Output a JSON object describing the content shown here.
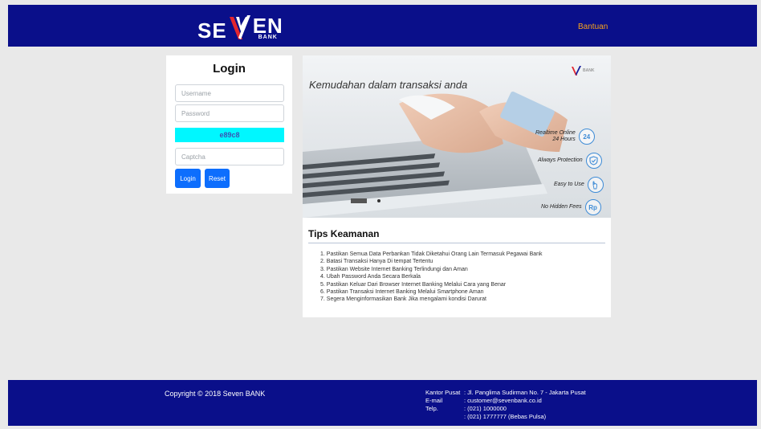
{
  "header": {
    "logo": {
      "left": "SE",
      "right": "EN",
      "sub": "BANK"
    },
    "help_link": "Bantuan"
  },
  "login": {
    "title": "Login",
    "username_placeholder": "Username",
    "password_placeholder": "Password",
    "captcha_code": "e89c8",
    "captcha_placeholder": "Captcha",
    "login_button": "Login",
    "reset_button": "Reset"
  },
  "hero": {
    "tagline": "Kemudahan dalam transaksi anda",
    "logo_text": "BANK",
    "features": [
      {
        "text_line1": "Realtime Online",
        "text_line2": "24 Hours",
        "icon": "24-hours-icon",
        "icon_text": "24"
      },
      {
        "text_line1": "Always Protection",
        "icon": "shield-check-icon"
      },
      {
        "text_line1": "Easy to Use",
        "icon": "hand-tap-icon"
      },
      {
        "text_line1": "No Hidden Fees",
        "icon": "rupiah-icon",
        "icon_text": "Rp"
      }
    ]
  },
  "tips": {
    "title": "Tips Keamanan",
    "items": [
      "1. Pastikan Semua Data Perbankan Tidak Diketahui Orang Lain Termasuk Pegawai Bank",
      "2. Batasi Transaksi Hanya Di tempat Tertentu",
      "3. Pastikan Website Internet Banking Terlindungi dan Aman",
      "4. Ubah Password Anda Secara Berkala",
      "5. Pastikan Keluar Dari Browser Internet Banking Melalui Cara yang Benar",
      "6. Pastikan Transaksi Internet Banking Melalui Smartphone Aman",
      "7. Segera Menginformasikan Bank Jika mengalami kondisi Darurat"
    ]
  },
  "footer": {
    "copyright": "Copyright © 2018 Seven BANK",
    "contact": [
      {
        "label": "Kantor Pusat",
        "value": ": Jl. Panglima Sudirman No. 7 - Jakarta Pusat"
      },
      {
        "label": "E-mail",
        "value": ": customer@sevenbank.co.id"
      },
      {
        "label": "Telp.",
        "value": ": (021) 1000000"
      },
      {
        "label": "",
        "value": ": (021) 1777777 (Bebas Pulsa)"
      }
    ]
  },
  "colors": {
    "brand_navy": "#0a0f8a",
    "accent_orange": "#f7a21b",
    "button_blue": "#0d6efd",
    "captcha_cyan": "#00f7ff",
    "logo_red": "#e3262f"
  }
}
